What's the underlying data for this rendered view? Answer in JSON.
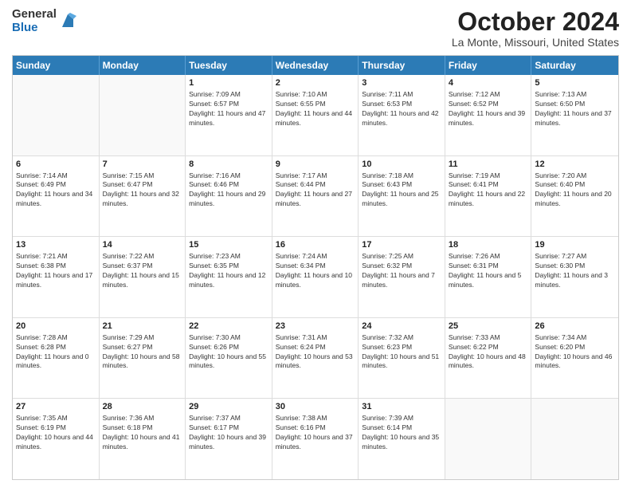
{
  "logo": {
    "general": "General",
    "blue": "Blue"
  },
  "title": {
    "month": "October 2024",
    "location": "La Monte, Missouri, United States"
  },
  "header": {
    "days": [
      "Sunday",
      "Monday",
      "Tuesday",
      "Wednesday",
      "Thursday",
      "Friday",
      "Saturday"
    ]
  },
  "weeks": [
    [
      {
        "day": "",
        "sunrise": "",
        "sunset": "",
        "daylight": ""
      },
      {
        "day": "",
        "sunrise": "",
        "sunset": "",
        "daylight": ""
      },
      {
        "day": "1",
        "sunrise": "Sunrise: 7:09 AM",
        "sunset": "Sunset: 6:57 PM",
        "daylight": "Daylight: 11 hours and 47 minutes."
      },
      {
        "day": "2",
        "sunrise": "Sunrise: 7:10 AM",
        "sunset": "Sunset: 6:55 PM",
        "daylight": "Daylight: 11 hours and 44 minutes."
      },
      {
        "day": "3",
        "sunrise": "Sunrise: 7:11 AM",
        "sunset": "Sunset: 6:53 PM",
        "daylight": "Daylight: 11 hours and 42 minutes."
      },
      {
        "day": "4",
        "sunrise": "Sunrise: 7:12 AM",
        "sunset": "Sunset: 6:52 PM",
        "daylight": "Daylight: 11 hours and 39 minutes."
      },
      {
        "day": "5",
        "sunrise": "Sunrise: 7:13 AM",
        "sunset": "Sunset: 6:50 PM",
        "daylight": "Daylight: 11 hours and 37 minutes."
      }
    ],
    [
      {
        "day": "6",
        "sunrise": "Sunrise: 7:14 AM",
        "sunset": "Sunset: 6:49 PM",
        "daylight": "Daylight: 11 hours and 34 minutes."
      },
      {
        "day": "7",
        "sunrise": "Sunrise: 7:15 AM",
        "sunset": "Sunset: 6:47 PM",
        "daylight": "Daylight: 11 hours and 32 minutes."
      },
      {
        "day": "8",
        "sunrise": "Sunrise: 7:16 AM",
        "sunset": "Sunset: 6:46 PM",
        "daylight": "Daylight: 11 hours and 29 minutes."
      },
      {
        "day": "9",
        "sunrise": "Sunrise: 7:17 AM",
        "sunset": "Sunset: 6:44 PM",
        "daylight": "Daylight: 11 hours and 27 minutes."
      },
      {
        "day": "10",
        "sunrise": "Sunrise: 7:18 AM",
        "sunset": "Sunset: 6:43 PM",
        "daylight": "Daylight: 11 hours and 25 minutes."
      },
      {
        "day": "11",
        "sunrise": "Sunrise: 7:19 AM",
        "sunset": "Sunset: 6:41 PM",
        "daylight": "Daylight: 11 hours and 22 minutes."
      },
      {
        "day": "12",
        "sunrise": "Sunrise: 7:20 AM",
        "sunset": "Sunset: 6:40 PM",
        "daylight": "Daylight: 11 hours and 20 minutes."
      }
    ],
    [
      {
        "day": "13",
        "sunrise": "Sunrise: 7:21 AM",
        "sunset": "Sunset: 6:38 PM",
        "daylight": "Daylight: 11 hours and 17 minutes."
      },
      {
        "day": "14",
        "sunrise": "Sunrise: 7:22 AM",
        "sunset": "Sunset: 6:37 PM",
        "daylight": "Daylight: 11 hours and 15 minutes."
      },
      {
        "day": "15",
        "sunrise": "Sunrise: 7:23 AM",
        "sunset": "Sunset: 6:35 PM",
        "daylight": "Daylight: 11 hours and 12 minutes."
      },
      {
        "day": "16",
        "sunrise": "Sunrise: 7:24 AM",
        "sunset": "Sunset: 6:34 PM",
        "daylight": "Daylight: 11 hours and 10 minutes."
      },
      {
        "day": "17",
        "sunrise": "Sunrise: 7:25 AM",
        "sunset": "Sunset: 6:32 PM",
        "daylight": "Daylight: 11 hours and 7 minutes."
      },
      {
        "day": "18",
        "sunrise": "Sunrise: 7:26 AM",
        "sunset": "Sunset: 6:31 PM",
        "daylight": "Daylight: 11 hours and 5 minutes."
      },
      {
        "day": "19",
        "sunrise": "Sunrise: 7:27 AM",
        "sunset": "Sunset: 6:30 PM",
        "daylight": "Daylight: 11 hours and 3 minutes."
      }
    ],
    [
      {
        "day": "20",
        "sunrise": "Sunrise: 7:28 AM",
        "sunset": "Sunset: 6:28 PM",
        "daylight": "Daylight: 11 hours and 0 minutes."
      },
      {
        "day": "21",
        "sunrise": "Sunrise: 7:29 AM",
        "sunset": "Sunset: 6:27 PM",
        "daylight": "Daylight: 10 hours and 58 minutes."
      },
      {
        "day": "22",
        "sunrise": "Sunrise: 7:30 AM",
        "sunset": "Sunset: 6:26 PM",
        "daylight": "Daylight: 10 hours and 55 minutes."
      },
      {
        "day": "23",
        "sunrise": "Sunrise: 7:31 AM",
        "sunset": "Sunset: 6:24 PM",
        "daylight": "Daylight: 10 hours and 53 minutes."
      },
      {
        "day": "24",
        "sunrise": "Sunrise: 7:32 AM",
        "sunset": "Sunset: 6:23 PM",
        "daylight": "Daylight: 10 hours and 51 minutes."
      },
      {
        "day": "25",
        "sunrise": "Sunrise: 7:33 AM",
        "sunset": "Sunset: 6:22 PM",
        "daylight": "Daylight: 10 hours and 48 minutes."
      },
      {
        "day": "26",
        "sunrise": "Sunrise: 7:34 AM",
        "sunset": "Sunset: 6:20 PM",
        "daylight": "Daylight: 10 hours and 46 minutes."
      }
    ],
    [
      {
        "day": "27",
        "sunrise": "Sunrise: 7:35 AM",
        "sunset": "Sunset: 6:19 PM",
        "daylight": "Daylight: 10 hours and 44 minutes."
      },
      {
        "day": "28",
        "sunrise": "Sunrise: 7:36 AM",
        "sunset": "Sunset: 6:18 PM",
        "daylight": "Daylight: 10 hours and 41 minutes."
      },
      {
        "day": "29",
        "sunrise": "Sunrise: 7:37 AM",
        "sunset": "Sunset: 6:17 PM",
        "daylight": "Daylight: 10 hours and 39 minutes."
      },
      {
        "day": "30",
        "sunrise": "Sunrise: 7:38 AM",
        "sunset": "Sunset: 6:16 PM",
        "daylight": "Daylight: 10 hours and 37 minutes."
      },
      {
        "day": "31",
        "sunrise": "Sunrise: 7:39 AM",
        "sunset": "Sunset: 6:14 PM",
        "daylight": "Daylight: 10 hours and 35 minutes."
      },
      {
        "day": "",
        "sunrise": "",
        "sunset": "",
        "daylight": ""
      },
      {
        "day": "",
        "sunrise": "",
        "sunset": "",
        "daylight": ""
      }
    ]
  ]
}
